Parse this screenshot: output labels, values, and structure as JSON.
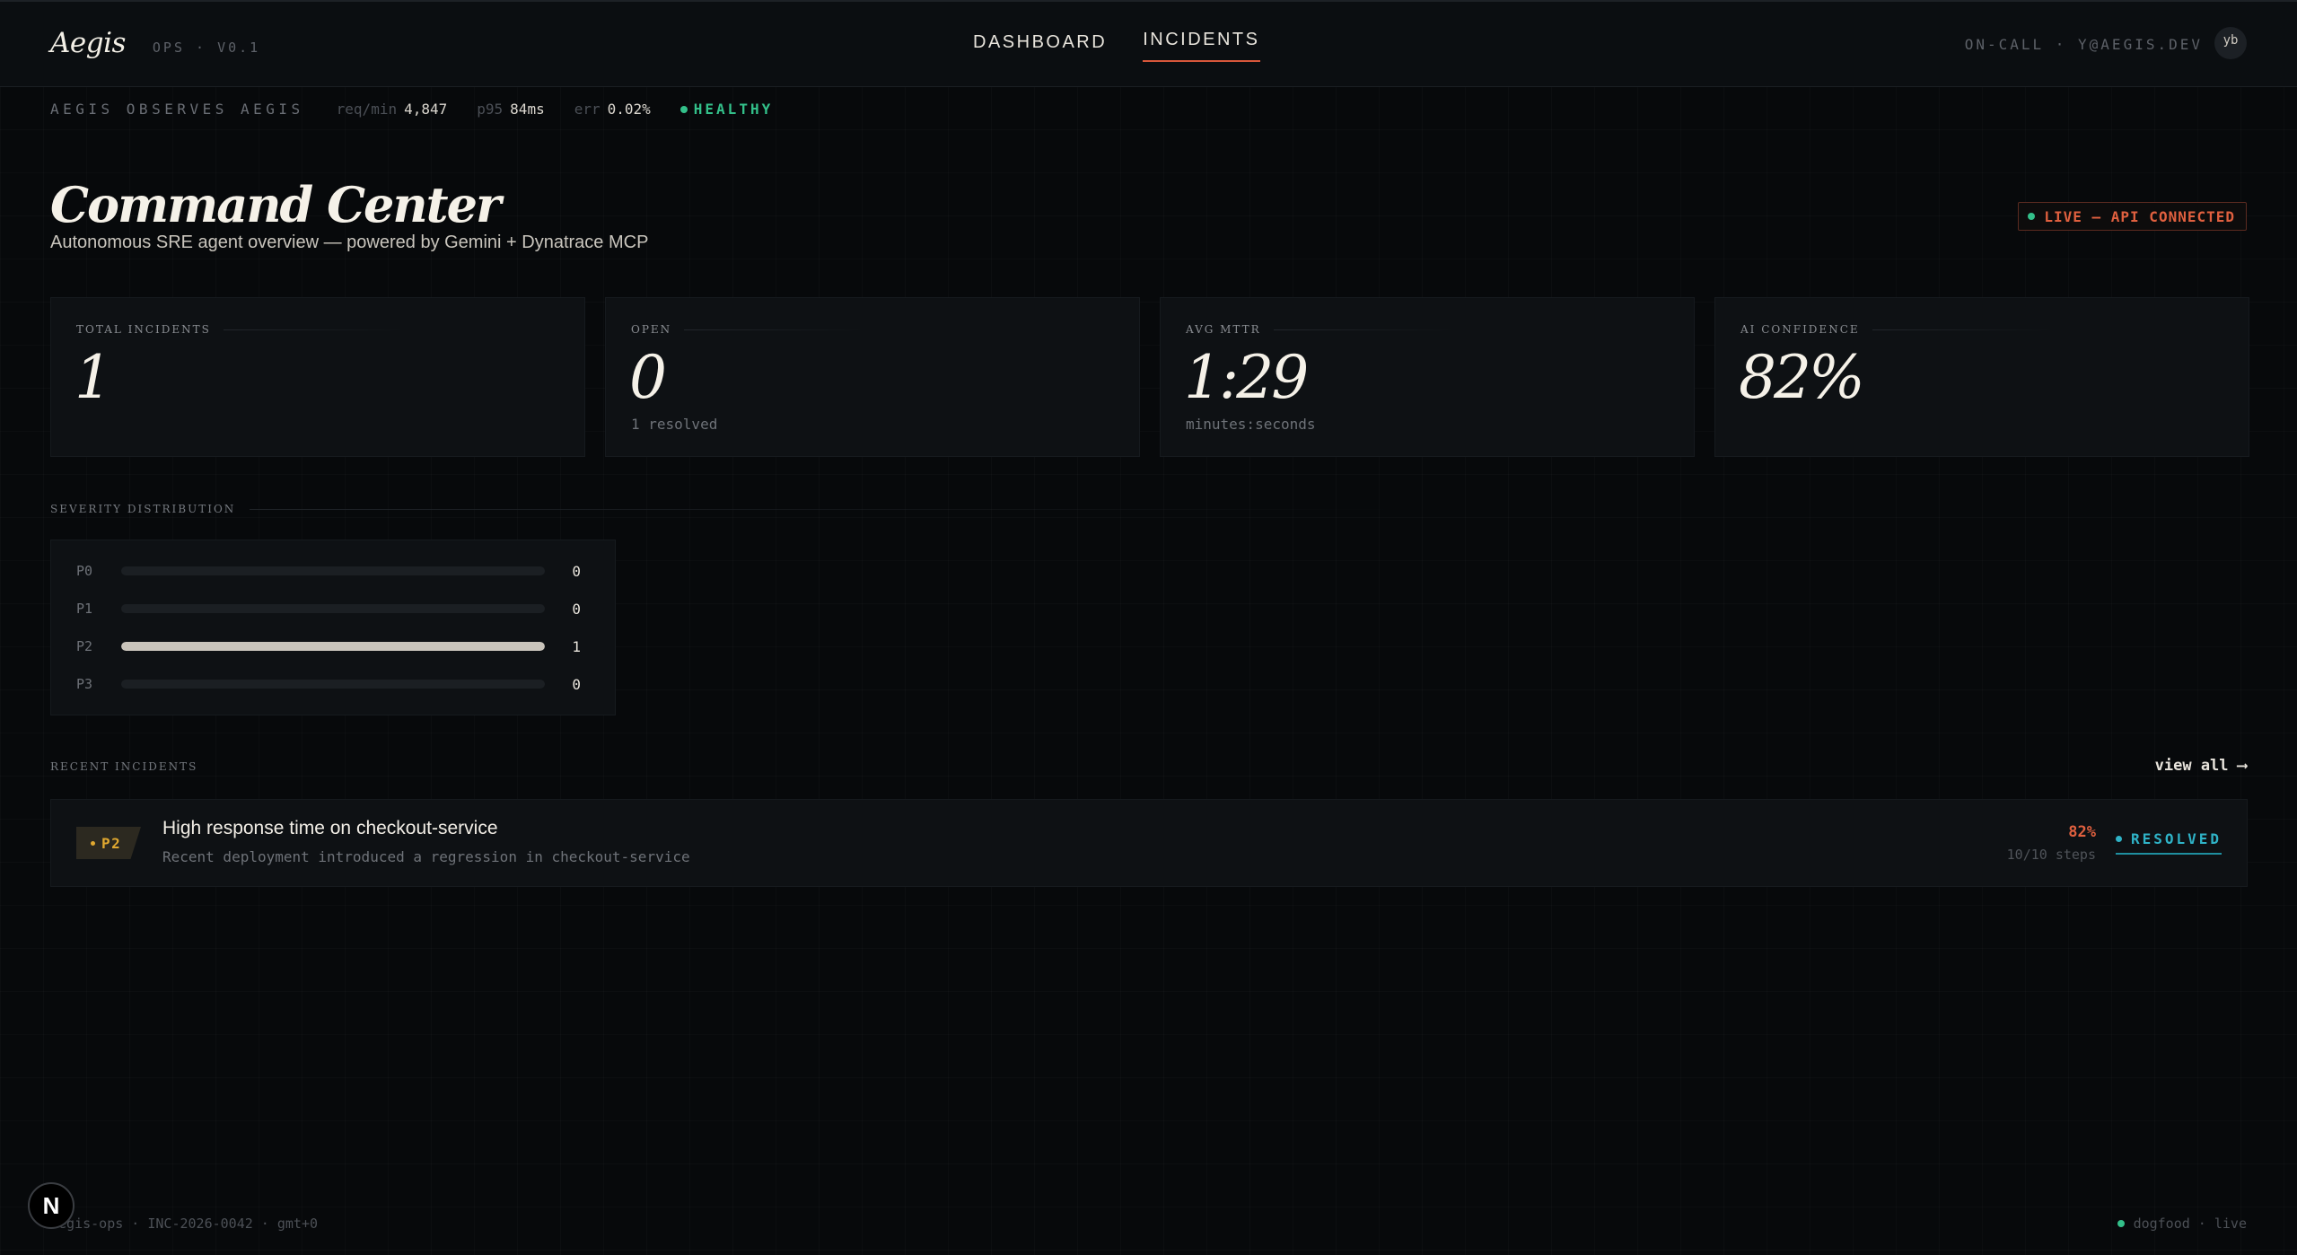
{
  "nav": {
    "brand": "Aegis",
    "brand_sub": "OPS · V0.1",
    "links": [
      "DASHBOARD",
      "INCIDENTS"
    ],
    "active_link": "INCIDENTS",
    "oncall": "ON-CALL · Y@AEGIS.DEV",
    "avatar": "yb"
  },
  "strip": {
    "title": "AEGIS OBSERVES AEGIS",
    "metrics": [
      {
        "key": "req/min",
        "value": "4,847"
      },
      {
        "key": "p95",
        "value": "84ms"
      },
      {
        "key": "err",
        "value": "0.02%"
      }
    ],
    "status": "HEALTHY",
    "status_color": "#33c08a"
  },
  "header": {
    "title": "Command Center",
    "subtitle": "Autonomous SRE agent overview — powered by Gemini + Dynatrace MCP",
    "live_badge": "LIVE — API CONNECTED"
  },
  "stats": [
    {
      "label": "TOTAL INCIDENTS",
      "value": "1",
      "foot": ""
    },
    {
      "label": "OPEN",
      "value": "0",
      "foot": "1 resolved"
    },
    {
      "label": "AVG MTTR",
      "value": "1:29",
      "foot": "minutes:seconds"
    },
    {
      "label": "AI CONFIDENCE",
      "value": "82%",
      "foot": ""
    }
  ],
  "severity": {
    "label": "SEVERITY DISTRIBUTION",
    "rows": [
      {
        "label": "P0",
        "count": "0",
        "fraction": 0
      },
      {
        "label": "P1",
        "count": "0",
        "fraction": 0
      },
      {
        "label": "P2",
        "count": "1",
        "fraction": 1
      },
      {
        "label": "P3",
        "count": "0",
        "fraction": 0
      }
    ]
  },
  "recent": {
    "label": "RECENT INCIDENTS",
    "view_all": "view all ⟶",
    "items": [
      {
        "priority": "P2",
        "title": "High response time on checkout-service",
        "description": "Recent deployment introduced a regression in checkout-service",
        "confidence": "82%",
        "steps": "10/10 steps",
        "status": "RESOLVED"
      }
    ]
  },
  "footer": {
    "left": "aegis-ops · INC-2026-0042 · gmt+0",
    "right": "dogfood · live"
  },
  "colors": {
    "accent": "#d8573a",
    "priority_p2": "#e0a830",
    "resolved": "#2fb3c7",
    "healthy": "#33c08a"
  }
}
